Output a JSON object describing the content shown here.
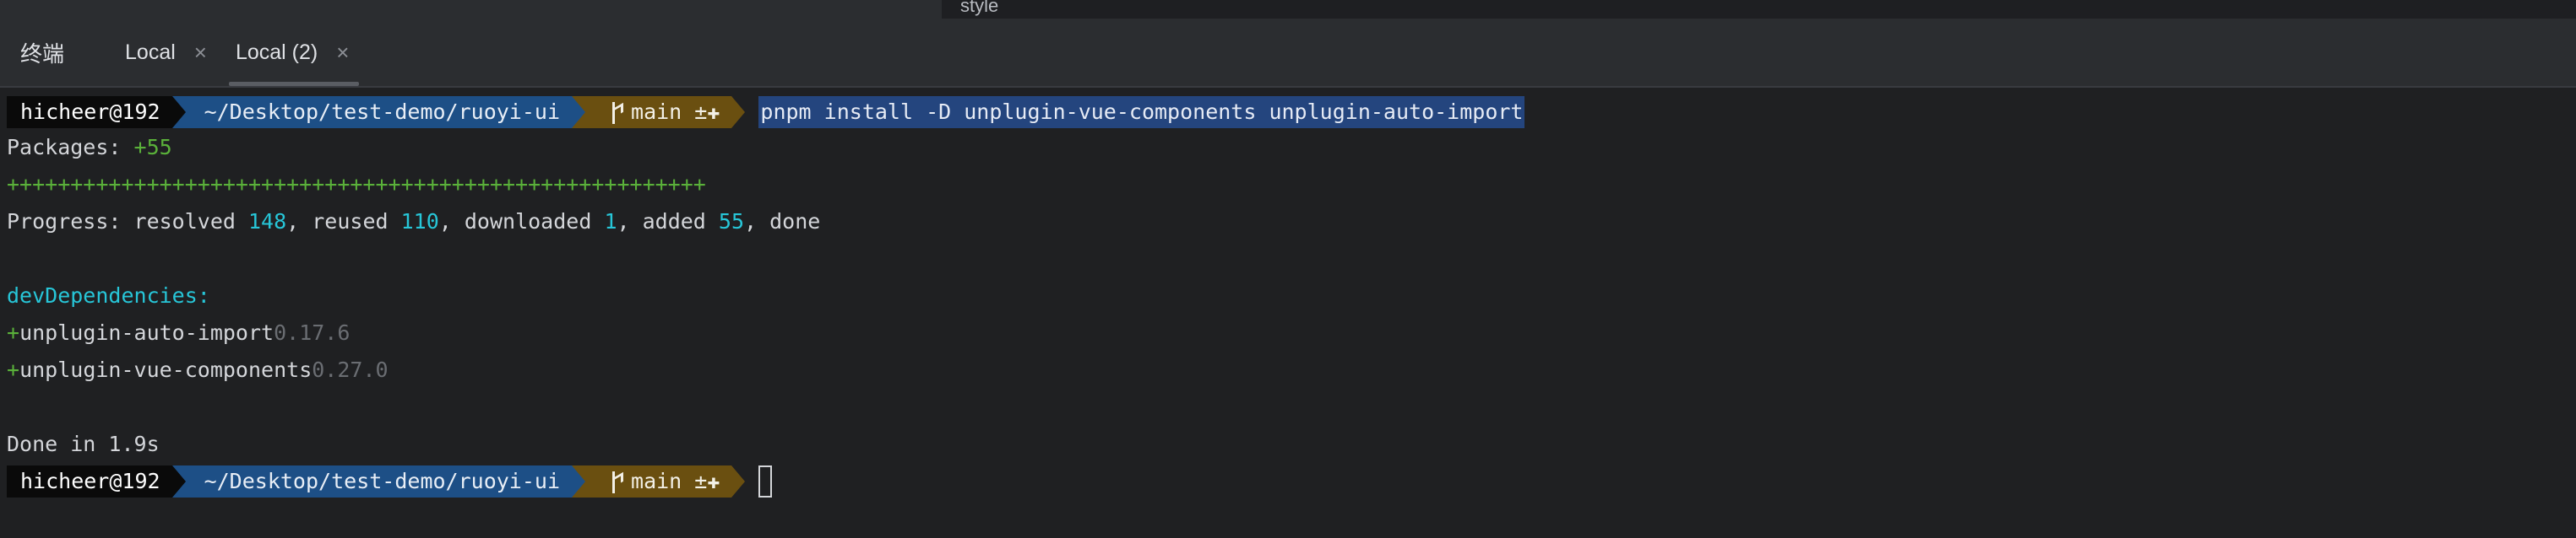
{
  "topbar": {
    "hint": "style"
  },
  "tabbar": {
    "title": "终端",
    "tabs": [
      {
        "label": "Local",
        "close": "×",
        "active": false
      },
      {
        "label": "Local (2)",
        "close": "×",
        "active": true
      }
    ]
  },
  "prompt": {
    "user": "hicheer@192",
    "path": "~/Desktop/test-demo/ruoyi-ui",
    "branch": "main",
    "git_status": "±✚"
  },
  "terminal": {
    "command": "pnpm install -D unplugin-vue-components unplugin-auto-import",
    "packages_label": "Packages: ",
    "packages_value": "+55",
    "progress_bar": "+++++++++++++++++++++++++++++++++++++++++++++++++++++++",
    "progress_label": "Progress: resolved ",
    "resolved": "148",
    "reused_label": ", reused ",
    "reused": "110",
    "downloaded_label": ", downloaded ",
    "downloaded": "1",
    "added_label": ", added ",
    "added": "55",
    "done_label": ", done",
    "dev_header": "devDependencies:",
    "deps": [
      {
        "plus": "+",
        "name": "unplugin-auto-import",
        "version": "0.17.6"
      },
      {
        "plus": "+",
        "name": "unplugin-vue-components",
        "version": "0.27.0"
      }
    ],
    "done": "Done in 1.9s"
  },
  "colors": {
    "background": "#1f2022",
    "user_segment": "#0a0a0a",
    "path_segment": "#1d4f86",
    "git_segment": "#6a4f10",
    "selection": "#24457e",
    "green": "#5ab13a",
    "cyan": "#27c6d8"
  }
}
